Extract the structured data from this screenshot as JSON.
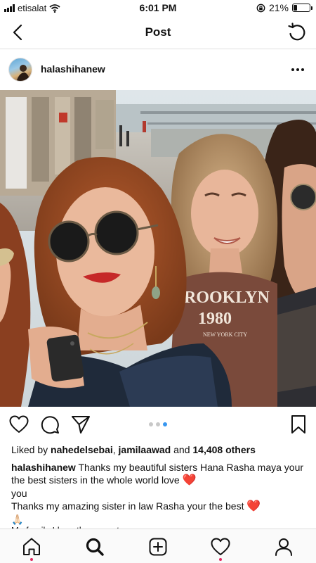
{
  "status_bar": {
    "carrier": "etisalat",
    "time": "6:01 PM",
    "battery": "21%",
    "battery_level": 0.21
  },
  "nav": {
    "title": "Post"
  },
  "post": {
    "username": "halashihanew",
    "image_text": {
      "shirt_line1": "ROOKLYN",
      "shirt_line2": "1980",
      "shirt_line3": "NEW YORK CITY"
    },
    "carousel": {
      "count": 3,
      "active_index": 2
    },
    "likes": {
      "prefix": "Liked by ",
      "user1": "nahedelsebai",
      "separator": ", ",
      "user2": "jamilaawad",
      "middle": " and ",
      "others": "14,408 others"
    },
    "caption": {
      "author": "halashihanew",
      "line1": "Thanks my beautiful sisters Hana Rasha maya your the best sisters in the whole world love",
      "line1_end": "you",
      "line2": "Thanks my amazing sister in law Rasha your the best",
      "line3": "My family I love them most",
      "heart_emoji": "❤️",
      "pray_emoji": "🙏🏻"
    }
  },
  "colors": {
    "accent_blue": "#3897f0",
    "notification_red": "#e0245e"
  },
  "tab_bar": {
    "items": [
      "home-icon",
      "search-icon",
      "new-post-icon",
      "activity-icon",
      "profile-icon"
    ]
  }
}
